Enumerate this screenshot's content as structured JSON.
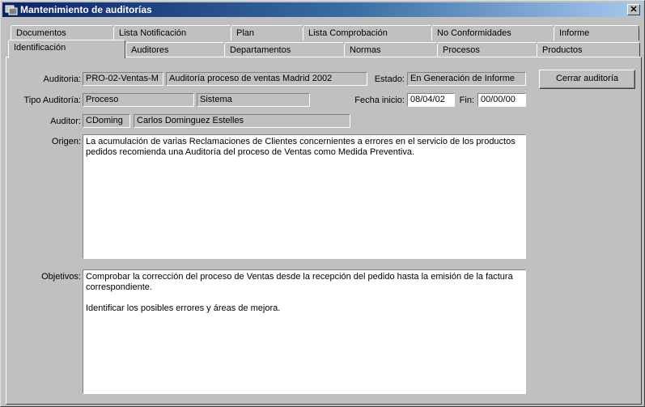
{
  "window": {
    "title": "Mantenimiento de auditorías",
    "close_label": "✕"
  },
  "tabs_back": [
    "Documentos",
    "Lista Notificación",
    "Plan",
    "Lista Comprobación",
    "No Conformidades",
    "Informe"
  ],
  "tabs_front": [
    "Identificación",
    "Auditores",
    "Departamentos",
    "Normas",
    "Procesos",
    "Productos"
  ],
  "active_tab": "Identificación",
  "form": {
    "auditoria_label": "Auditoria:",
    "auditoria_code": "PRO-02-Ventas-M",
    "auditoria_name": "Auditoría proceso de ventas Madrid 2002",
    "estado_label": "Estado:",
    "estado_value": "En Generación de Informe",
    "tipo_label": "Tipo Auditoría:",
    "tipo_value": "Proceso",
    "tipo_sub": "Sistema",
    "fecha_inicio_label": "Fecha inicio:",
    "fecha_inicio_value": "08/04/02",
    "fin_label": "Fin:",
    "fin_value": "00/00/00",
    "auditor_label": "Auditor:",
    "auditor_code": "CDoming",
    "auditor_name": "Carlos Dominguez Estelles",
    "origen_label": "Origen:",
    "origen_text": "La acumulación de varias Reclamaciones de Clientes concernientes a errores en el servicio de los productos\npedidos recomienda una Auditoría del proceso de Ventas como Medida Preventiva.",
    "objetivos_label": "Objetivos:",
    "objetivos_text": "Comprobar la corrección del proceso de Ventas desde la recepción del pedido hasta la emisión de la factura\ncorrespondiente.\n\nIdentificar los posibles errores y áreas de mejora."
  },
  "buttons": {
    "cerrar": "Cerrar auditoría"
  }
}
